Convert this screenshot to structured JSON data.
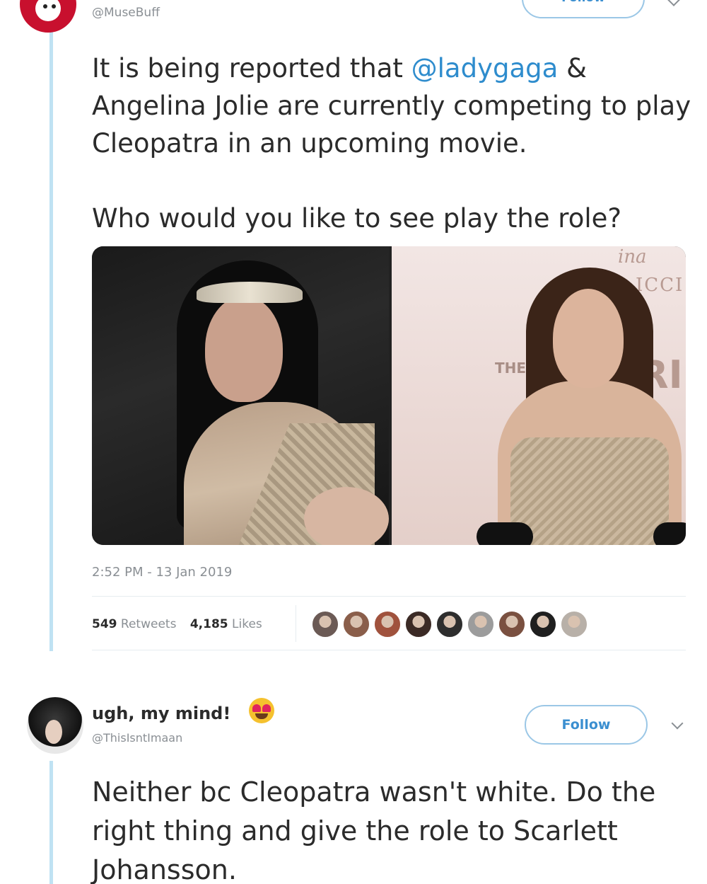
{
  "tweet": {
    "handle": "@MuseBuff",
    "follow_label": "Follow",
    "text_before": "It is being reported that ",
    "mention": "@ladygaga",
    "text_after": " & Angelina Jolie are currently competing to play Cleopatra in an upcoming movie.",
    "question": "Who would you like to see play the role?",
    "timestamp": "2:52 PM - 13 Jan 2019",
    "retweets_count": "549",
    "retweets_label": "Retweets",
    "likes_count": "4,185",
    "likes_label": "Likes",
    "image_text": {
      "the": "THE",
      "icci": "ICCI",
      "ina": "ina",
      "ri": "RI"
    },
    "liker_colors": [
      "#6b5a55",
      "#8a5e4a",
      "#a0523d",
      "#3b2a25",
      "#2e2e2e",
      "#9c9c9c",
      "#7a5040",
      "#1f1f1f",
      "#b8b0a8"
    ]
  },
  "reply": {
    "name": "ugh, my mind!",
    "emoji": "heart-eyes-emoji",
    "handle": "@ThisIsntImaan",
    "follow_label": "Follow",
    "text": "Neither bc Cleopatra wasn't white. Do the right thing and give the role to Scarlett Johansson."
  },
  "colors": {
    "link": "#2e8ccd",
    "thread_line": "#bfe2f3",
    "follow_border": "#9bc7e6"
  }
}
